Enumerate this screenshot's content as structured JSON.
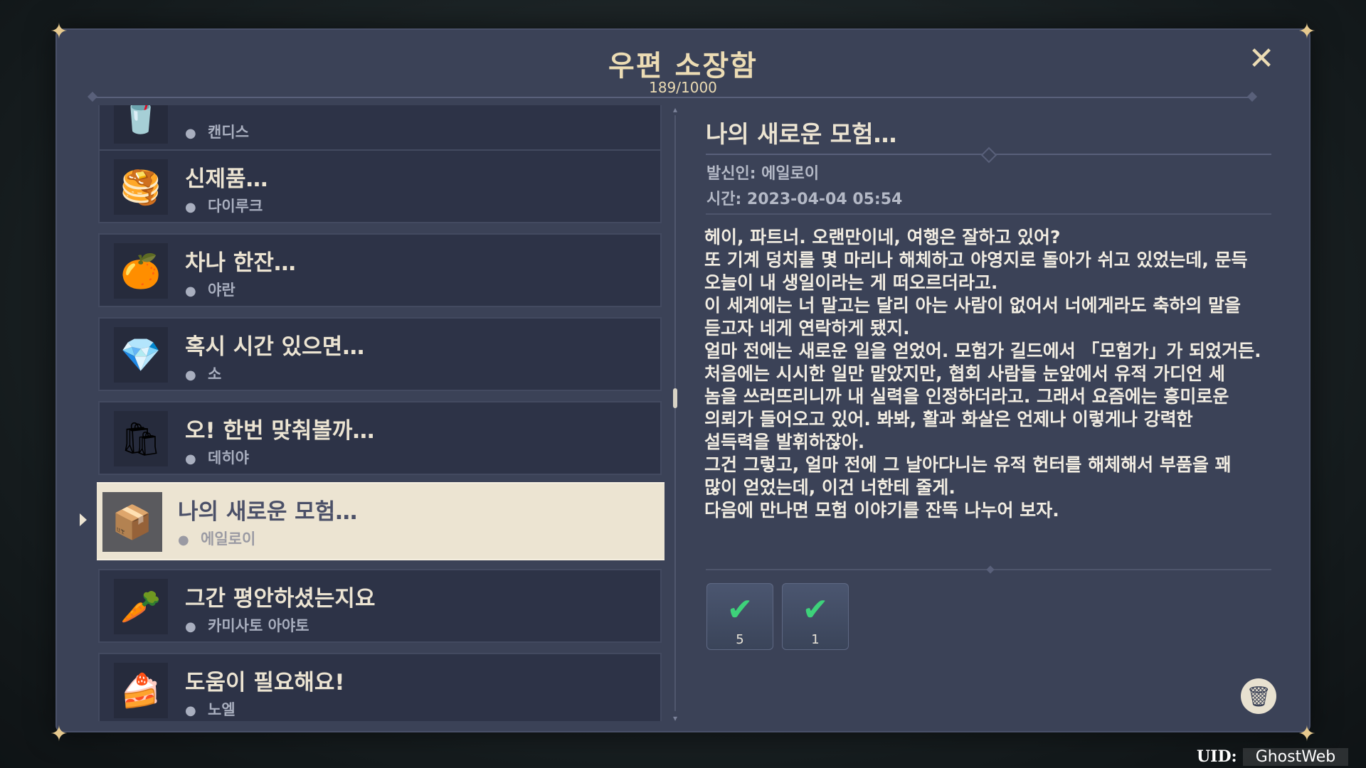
{
  "window": {
    "title": "우편 소장함",
    "count": "189/1000"
  },
  "mail_list": [
    {
      "subject": "",
      "sender": "캔디스",
      "icon": "juice-icon"
    },
    {
      "subject": "신제품…",
      "sender": "다이루크",
      "icon": "pancake-stack-icon"
    },
    {
      "subject": "차나 한잔…",
      "sender": "야란",
      "icon": "orange-fruit-icon"
    },
    {
      "subject": "혹시 시간 있으면…",
      "sender": "소",
      "icon": "crystal-shard-icon"
    },
    {
      "subject": "오! 한번 맞춰볼까…",
      "sender": "데히야",
      "icon": "flour-sack-icon"
    },
    {
      "subject": "나의 새로운 모험…",
      "sender": "에일로이",
      "icon": "parts-box-icon",
      "selected": true
    },
    {
      "subject": "그간 평안하셨는지요",
      "sender": "카미사토 아야토",
      "icon": "radish-icon"
    },
    {
      "subject": "도움이 필요해요!",
      "sender": "노엘",
      "icon": "cake-icon"
    }
  ],
  "detail": {
    "title": "나의 새로운 모험…",
    "sender": "발신인: 에일로이",
    "time": "시간: 2023-04-04 05:54",
    "body": "헤이, 파트너. 오랜만이네, 여행은 잘하고 있어?\n또 기계 덩치를 몇 마리나 해체하고 야영지로 돌아가 쉬고 있었는데, 문득\n오늘이 내 생일이라는 게 떠오르더라고.\n이 세계에는 너 말고는 달리 아는 사람이 없어서 너에게라도 축하의 말을\n듣고자 네게 연락하게 됐지.\n얼마 전에는 새로운 일을 얻었어. 모험가 길드에서 「모험가」가 되었거든.\n처음에는 시시한 일만 맡았지만, 협회 사람들 눈앞에서 유적 가디언 세\n놈을 쓰러뜨리니까 내 실력을 인정하더라고. 그래서 요즘에는 흥미로운\n의뢰가 들어오고 있어. 봐봐, 활과 화살은 언제나 이렇게나 강력한\n설득력을 발휘하잖아.\n그건 그렇고, 얼마 전에 그 날아다니는 유적 헌터를 해체해서 부품을 꽤\n많이 얻었는데, 이건 너한테 줄게.\n다음에 만나면 모험 이야기를 잔뜩 나누어 보자."
  },
  "attachments": [
    {
      "qty": "5",
      "icon": "claimed-parts-icon"
    },
    {
      "qty": "1",
      "icon": "claimed-gem-icon"
    }
  ],
  "footer": {
    "uid_label": "UID:",
    "uid_value": "GhostWeb"
  },
  "colors": {
    "panel": "#3b4257",
    "accent": "#ecdcb4",
    "selected": "#ece4d2",
    "item": "#2d3347"
  }
}
